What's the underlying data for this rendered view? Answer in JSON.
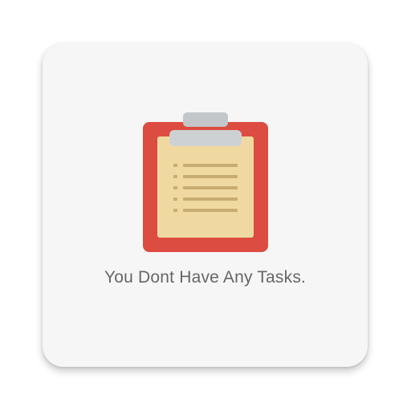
{
  "empty_state": {
    "message": "You Dont Have Any Tasks.",
    "illustration_icon": "clipboard-icon"
  },
  "colors": {
    "card_background": "#f6f6f6",
    "board_red": "#dd4c40",
    "paper": "#f0d9a0",
    "clip_gray": "#cdd1d4",
    "lines": "#c8ad72",
    "message_text": "#666666"
  }
}
